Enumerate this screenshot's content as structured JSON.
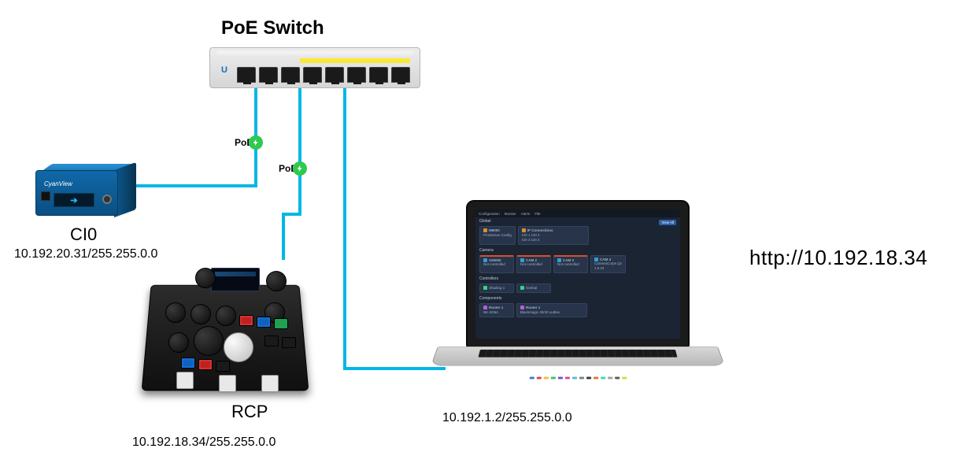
{
  "switch": {
    "title": "PoE Switch",
    "port_count": 8,
    "brand": "U"
  },
  "poe": {
    "label": "PoE"
  },
  "ci0": {
    "name": "CI0",
    "ip": "10.192.20.31/255.255.0.0",
    "brand": "CyanView",
    "screen_indicator": "➔"
  },
  "rcp": {
    "name": "RCP",
    "ip": "10.192.18.34/255.255.0.0"
  },
  "laptop": {
    "ip": "10.192.1.2/255.255.0.0",
    "url": "http://10.192.18.34",
    "ui": {
      "topbar": [
        "Configuration",
        "Monitor",
        "Alerts",
        "File"
      ],
      "badge": "View All",
      "sections": {
        "global": {
          "title": "Global",
          "cards": [
            {
              "title": "M6000",
              "sub": "Production Config",
              "mk": "#d98f2e"
            },
            {
              "title": "IP Connections",
              "lines": [
                "CI0 1  CI0 2",
                "CI0 3  CI0 4"
              ],
              "mk": "#d98f2e"
            }
          ]
        },
        "camera": {
          "title": "Camera",
          "cards": [
            {
              "title": "S26000",
              "sub": "Not controlled",
              "mk": "#2e9fd9",
              "bar": "#d94e2e"
            },
            {
              "title": "CAM 2",
              "sub": "Not controlled",
              "mk": "#2e9fd9",
              "bar": "#d94e2e"
            },
            {
              "title": "CAM 3",
              "sub": "Not controlled",
              "mk": "#2e9fd9",
              "bar": "#d94e2e"
            },
            {
              "title": "CAM 4",
              "sub": "CameraCorps Qx",
              "sub2": "1.0.24",
              "mk": "#2e9fd9"
            }
          ]
        },
        "controllers": {
          "title": "Controllers",
          "cards": [
            {
              "title": "Shading 1",
              "mk": "#2ed97c"
            },
            {
              "title": "Gimbal",
              "mk": "#2ed97c"
            }
          ]
        },
        "components": {
          "title": "Components",
          "cards": [
            {
              "title": "Router 1",
              "sub": "NK-3G64",
              "mk": "#b85fd9"
            },
            {
              "title": "Router 1",
              "sub": "Blackmagic 40/40 outline",
              "mk": "#b85fd9"
            }
          ]
        }
      },
      "dock_colors": [
        "#3a78d8",
        "#d84a3a",
        "#e8c03a",
        "#3ac06a",
        "#7a4ad8",
        "#d84a9a",
        "#4ac0d8",
        "#808080",
        "#3a3a3a",
        "#d87a3a",
        "#3ad8b0",
        "#a0a0a0",
        "#5a5a5a",
        "#d8d83a"
      ]
    }
  },
  "colors": {
    "cable": "#00b7e6",
    "poe_badge": "#2ec94f"
  }
}
